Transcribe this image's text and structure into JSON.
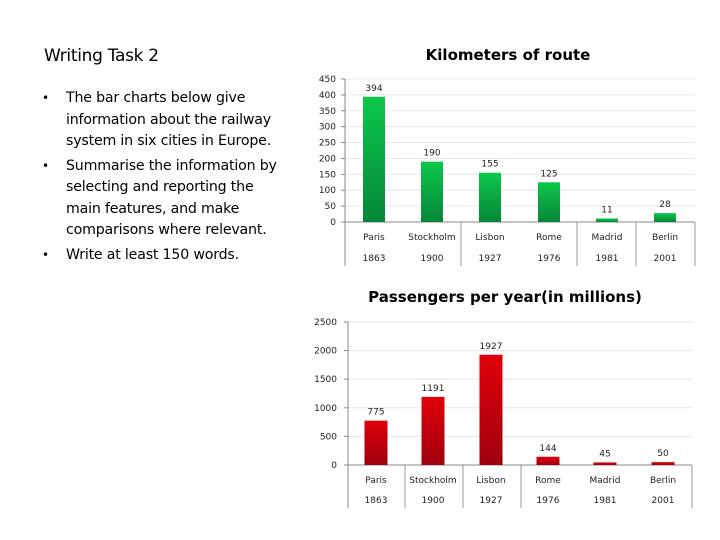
{
  "slide": {
    "title": "Writing Task 2",
    "bullets": [
      {
        "icon": "bullet-icon",
        "lines": [
          "The bar charts below give",
          "information about the railway",
          "system in six cities in Europe."
        ]
      },
      {
        "icon": "bullet-icon",
        "lines": [
          "Summarise the information by",
          "selecting and reporting the",
          "main features, and make",
          "comparisons where relevant."
        ]
      },
      {
        "icon": "bullet-icon",
        "lines": [
          "Write at least 150 words."
        ]
      }
    ]
  },
  "chart_data": [
    {
      "type": "bar",
      "title": "Kilometers of route",
      "categories": [
        "Paris",
        "Stockholm",
        "Lisbon",
        "Rome",
        "Madrid",
        "Berlin"
      ],
      "subcategories": [
        "1863",
        "1900",
        "1927",
        "1976",
        "1981",
        "2001"
      ],
      "values": [
        394,
        190,
        155,
        125,
        11,
        28
      ],
      "data_labels": [
        "394",
        "190",
        "155",
        "125",
        "11",
        "28"
      ],
      "xlabel": "",
      "ylabel": "",
      "ylim": [
        0,
        450
      ],
      "yticks": [
        0,
        50,
        100,
        150,
        200,
        250,
        300,
        350,
        400,
        450
      ],
      "grid": true,
      "legend": "none",
      "color": "#0aa63c"
    },
    {
      "type": "bar",
      "title": "Passengers per year(in millions)",
      "categories": [
        "Paris",
        "Stockholm",
        "Lisbon",
        "Rome",
        "Madrid",
        "Berlin"
      ],
      "subcategories": [
        "1863",
        "1900",
        "1927",
        "1976",
        "1981",
        "2001"
      ],
      "values": [
        775,
        1191,
        1927,
        144,
        45,
        50
      ],
      "data_labels": [
        "775",
        "1191",
        "1927",
        "144",
        "45",
        "50"
      ],
      "xlabel": "",
      "ylabel": "",
      "ylim": [
        0,
        2500
      ],
      "yticks": [
        0,
        500,
        1000,
        1500,
        2000,
        2500
      ],
      "grid": true,
      "legend": "none",
      "color": "#c8000a"
    }
  ]
}
